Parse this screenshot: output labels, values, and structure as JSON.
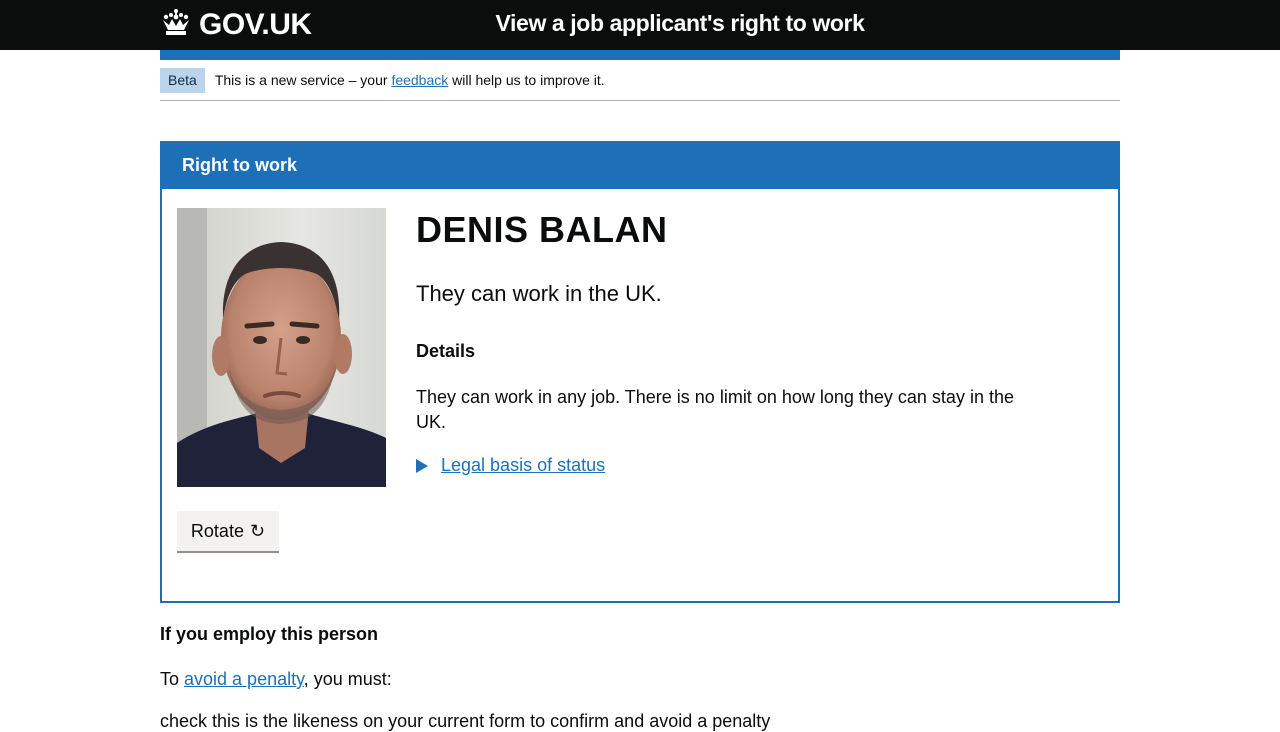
{
  "header": {
    "logo_text": "GOV.UK",
    "service_name": "View a job applicant's right to work"
  },
  "phase_banner": {
    "tag": "Beta",
    "text_before": "This is a new service – your ",
    "link": "feedback",
    "text_after": " will help us to improve it."
  },
  "panel": {
    "heading": "Right to work",
    "name": "DENIS BALAN",
    "status": "They can work in the UK.",
    "details_heading": "Details",
    "details_body": "They can work in any job. There is no limit on how long they can stay in the UK.",
    "legal_link": "Legal basis of status",
    "rotate_label": "Rotate",
    "rotate_glyph": "↻"
  },
  "employ": {
    "heading": "If you employ this person",
    "line_before": "To ",
    "line_link": "avoid a penalty",
    "line_after": ", you must:",
    "next_line": "check this is the likeness on your current form to confirm and avoid a penalty"
  },
  "colors": {
    "header_bg": "#0b0c0c",
    "brand_blue": "#1d70b8",
    "beta_tag_bg": "#bbd4ea",
    "button_bg": "#f3f2f1"
  }
}
